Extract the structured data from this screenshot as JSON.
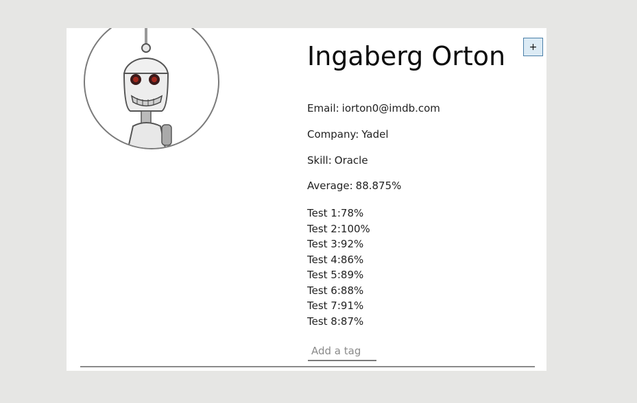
{
  "student": {
    "name": "Ingaberg Orton",
    "avatar_icon": "robot-avatar-icon",
    "email_label": "Email:",
    "email": "iorton0@imdb.com",
    "company_label": "Company:",
    "company": "Yadel",
    "skill_label": "Skill:",
    "skill": "Oracle",
    "average_label": "Average:",
    "average": "88.875%",
    "grades": [
      {
        "label": "Test 1:",
        "value": "78%"
      },
      {
        "label": "Test 2:",
        "value": "100%"
      },
      {
        "label": "Test 3:",
        "value": "92%"
      },
      {
        "label": "Test 4:",
        "value": "86%"
      },
      {
        "label": "Test 5:",
        "value": "89%"
      },
      {
        "label": "Test 6:",
        "value": "88%"
      },
      {
        "label": "Test 7:",
        "value": "91%"
      },
      {
        "label": "Test 8:",
        "value": "87%"
      }
    ]
  },
  "expand_button": {
    "label": "+",
    "icon": "plus-icon"
  },
  "tag_input": {
    "placeholder": "Add a tag",
    "value": ""
  },
  "colors": {
    "page_background": "#e6e6e4",
    "card_background": "#ffffff",
    "expand_button_bg": "#dcebf5",
    "expand_button_border": "#4a7fa8",
    "robot_eyes": "#8b1a1a"
  }
}
